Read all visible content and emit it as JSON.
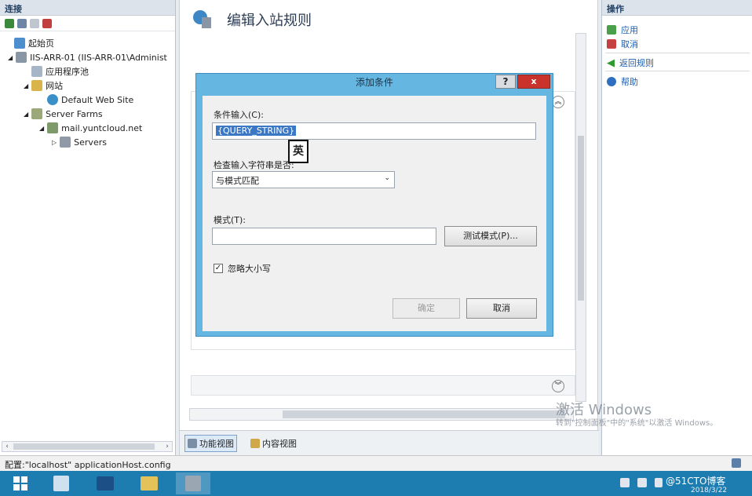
{
  "left_pane": {
    "header": "连接",
    "tree": [
      {
        "label": "起始页",
        "icon": "home-page-icon"
      },
      {
        "label": "IIS-ARR-01 (IIS-ARR-01\\Administ",
        "icon": "server-icon"
      },
      {
        "label": "应用程序池",
        "icon": "app-pool-icon"
      },
      {
        "label": "网站",
        "icon": "sites-folder-icon"
      },
      {
        "label": "Default Web Site",
        "icon": "globe-icon"
      },
      {
        "label": "Server Farms",
        "icon": "server-farms-icon"
      },
      {
        "label": "mail.yuntcloud.net",
        "icon": "server-farm-icon"
      },
      {
        "label": "Servers",
        "icon": "servers-icon"
      }
    ]
  },
  "center": {
    "title": "编辑入站规则",
    "views": {
      "features": "功能视图",
      "content": "内容视图"
    }
  },
  "right_pane": {
    "header": "操作",
    "actions": [
      {
        "label": "应用",
        "icon": "apply-icon"
      },
      {
        "label": "取消",
        "icon": "cancel-icon"
      },
      {
        "label": "返回规则",
        "icon": "back-arrow-icon"
      },
      {
        "label": "帮助",
        "icon": "help-icon"
      }
    ]
  },
  "status_bar": {
    "text": "配置:\"localhost\" applicationHost.config"
  },
  "dialog": {
    "title": "添加条件",
    "help_label": "?",
    "close_label": "x",
    "condition_input_label": "条件输入(C):",
    "condition_input_value": "{QUERY_STRING}",
    "check_label": "检查输入字符串是否:",
    "check_value": "与模式匹配",
    "pattern_label": "模式(T):",
    "pattern_value": "",
    "test_pattern_button": "测试模式(P)...",
    "ignore_case_label": "忽略大小写",
    "ignore_case_checked": true,
    "ok_button": "确定",
    "cancel_button": "取消"
  },
  "ime_indicator": "英",
  "watermark": {
    "title": "激活 Windows",
    "subtitle": "转到\"控制面板\"中的\"系统\"以激活 Windows。"
  },
  "blog_mark": "@51CTO博客",
  "clock": "2018/3/22",
  "colors": {
    "taskbar": "#1d7cb0",
    "dialog_frame": "#66b6e2",
    "close": "#c9332b",
    "link": "#1a5fb4"
  }
}
